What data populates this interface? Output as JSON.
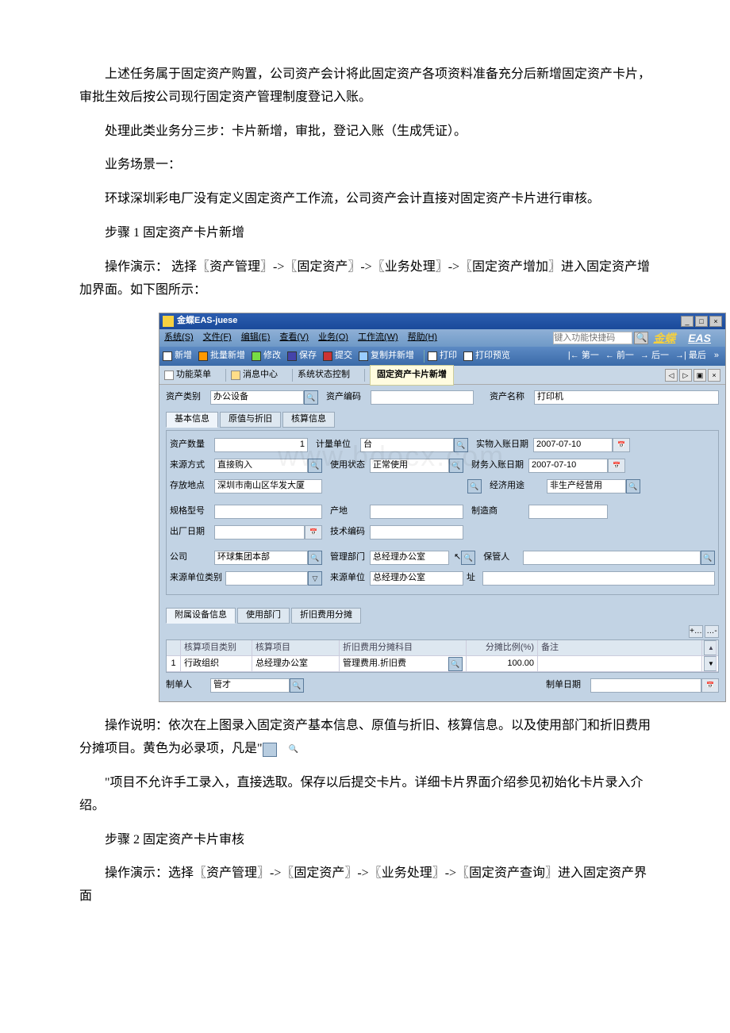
{
  "p1": "上述任务属于固定资产购置，公司资产会计将此固定资产各项资料准备充分后新增固定资产卡片，审批生效后按公司现行固定资产管理制度登记入账。",
  "p2": "处理此类业务分三步：卡片新增，审批，登记入账（生成凭证）。",
  "p3": "业务场景一：",
  "p4": "环球深圳彩电厂没有定义固定资产工作流，公司资产会计直接对固定资产卡片进行审核。",
  "p5": "步骤 1 固定资产卡片新增",
  "p6": "操作演示： 选择〖资产管理〗->〖固定资产〗->〖业务处理〗->〖固定资产增加〗进入固定资产增加界面。如下图所示：",
  "p7a": "操作说明：依次在上图录入固定资产基本信息、原值与折旧、核算信息。以及使用部门和折旧费用分摊项目。黄色为必录项，凡是\"",
  "p7b": "\"",
  "p8": "\"项目不允许手工录入，直接选取。保存以后提交卡片。详细卡片界面介绍参见初始化卡片录入介绍。",
  "p9": "步骤 2 固定资产卡片审核",
  "p10": "操作演示：选择〖资产管理〗->〖固定资产〗->〖业务处理〗->〖固定资产查询〗进入固定资产界面",
  "app": {
    "title": "金蝶EAS-juese",
    "brand_prefix": "金蝶",
    "brand_suffix": "EAS",
    "menus": [
      "系统(S)",
      "文件(F)",
      "编辑(E)",
      "查看(V)",
      "业务(O)",
      "工作流(W)",
      "帮助(H)"
    ],
    "shortcut_placeholder": "键入功能快捷码",
    "toolbar": [
      "新增",
      "批量新增",
      "修改",
      "保存",
      "提交",
      "复制并新增",
      "打印",
      "打印预览"
    ],
    "nav": [
      "|← 第一",
      "← 前一",
      "→ 后一",
      "→| 最后"
    ],
    "tabs_left": [
      "功能菜单",
      "消息中心",
      "系统状态控制"
    ],
    "active_tab": "固定资产卡片新增",
    "section1": {
      "asset_class_lbl": "资产类别",
      "asset_class": "办公设备",
      "asset_code_lbl": "资产编码",
      "asset_code": "",
      "asset_name_lbl": "资产名称",
      "asset_name": "打印机"
    },
    "subtabs": [
      "基本信息",
      "原值与折旧",
      "核算信息"
    ],
    "basic": {
      "qty_lbl": "资产数量",
      "qty": "1",
      "uom_lbl": "计量单位",
      "uom": "台",
      "physical_date_lbl": "实物入账日期",
      "physical_date": "2007-07-10",
      "source_lbl": "来源方式",
      "source": "直接购入",
      "status_lbl": "使用状态",
      "status": "正常使用",
      "finance_date_lbl": "财务入账日期",
      "finance_date": "2007-07-10",
      "loc_lbl": "存放地点",
      "loc": "深圳市南山区华发大厦",
      "usage_lbl": "经济用途",
      "usage": "非生产经营用",
      "model_lbl": "规格型号",
      "model": "",
      "origin_lbl": "产地",
      "origin": "",
      "vendor_lbl": "制造商",
      "vendor": "",
      "release_lbl": "出厂日期",
      "release": "",
      "tech_lbl": "技术编码",
      "tech": "",
      "company_lbl": "公司",
      "company": "环球集团本部",
      "dept_lbl": "管理部门",
      "dept": "总经理办公室",
      "keeper_lbl": "保管人",
      "keeper": "",
      "vendor_type_lbl": "来源单位类别",
      "vendor_type": "",
      "vendor_unit_lbl": "来源单位",
      "vendor_unit": "总经理办公室",
      "addr_lbl": "址"
    },
    "lower_tabs": [
      "附属设备信息",
      "使用部门",
      "折旧费用分摊"
    ],
    "grid": {
      "cols": [
        "",
        "核算项目类别",
        "核算项目",
        "折旧费用分摊科目",
        "分摊比例(%)",
        "备注"
      ],
      "row": [
        "1",
        "行政组织",
        "总经理办公室",
        "管理费用.折旧费",
        "100.00",
        ""
      ]
    },
    "footer": {
      "creator_lbl": "制单人",
      "creator": "管才",
      "date_lbl": "制单日期",
      "date": ""
    }
  }
}
